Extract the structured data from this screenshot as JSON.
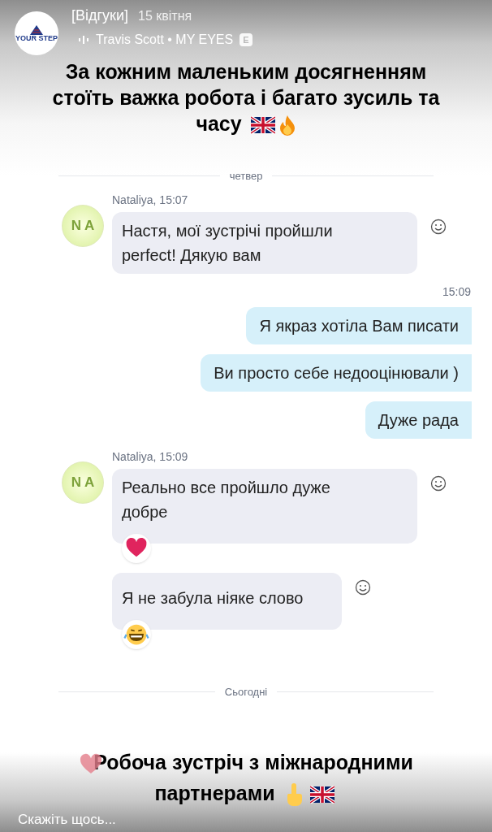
{
  "header": {
    "logo_text": "YOUR STEP",
    "title": "[Відгуки]",
    "date": "15 квітня",
    "music": "Travis Scott • MY EYES",
    "explicit_badge": "E"
  },
  "caption_top": "За кожним маленьким досягненням стоїть важка робота і багато зусиль та часу",
  "chat": {
    "day_top": "четвер",
    "messages": [
      {
        "kind": "incoming",
        "avatar": "N A",
        "sender": "Nataliya, 15:07",
        "text": "Настя, мої зустрічі пройшли perfect! Дякую вам"
      },
      {
        "kind": "time",
        "text": "15:09"
      },
      {
        "kind": "outgoing",
        "text": "Я якраз хотіла Вам писати"
      },
      {
        "kind": "outgoing",
        "text": "Ви просто себе недооцінювали )"
      },
      {
        "kind": "outgoing",
        "text": "Дуже рада"
      },
      {
        "kind": "incoming",
        "avatar": "N A",
        "sender": "Nataliya, 15:09",
        "text": "Реально все пройшло дуже добре",
        "reactions": [
          {
            "kind": "heart"
          }
        ]
      },
      {
        "kind": "incoming",
        "text": "Я не забула ніяке слово",
        "reactions": [
          {
            "kind": "laugh"
          }
        ]
      }
    ],
    "day_bottom": "Сьогодні"
  },
  "caption_bottom": "Робоча зустріч з міжнародними партнерами",
  "reply": {
    "placeholder": "Скажіть щось..."
  }
}
